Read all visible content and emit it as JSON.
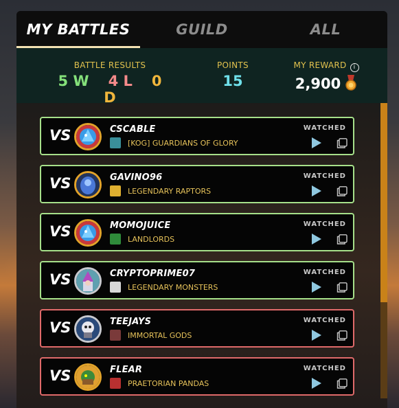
{
  "tabs": [
    {
      "label": "MY BATTLES",
      "active": true
    },
    {
      "label": "GUILD",
      "active": false
    },
    {
      "label": "ALL",
      "active": false
    }
  ],
  "summary": {
    "battle_results_label": "BATTLE RESULTS",
    "wins": "5 W",
    "losses": "4 L",
    "draws": "0 D",
    "points_label": "POINTS",
    "points": "15",
    "reward_label": "MY REWARD",
    "reward": "2,900"
  },
  "battles": [
    {
      "vs": "VS",
      "player": "CSCABLE",
      "guild": "[KOG] GUARDIANS OF GLORY",
      "status": "WATCHED",
      "result": "win",
      "guild_color": "#3a8f9a",
      "avatar_icon": "blue-dragon-avatar-icon"
    },
    {
      "vs": "VS",
      "player": "GAVINO96",
      "guild": "LEGENDARY RAPTORS",
      "status": "WATCHED",
      "result": "win",
      "guild_color": "#e0b030",
      "avatar_icon": "blue-mage-avatar-icon"
    },
    {
      "vs": "VS",
      "player": "MOMOJUICE",
      "guild": "LANDLORDS",
      "status": "WATCHED",
      "result": "win",
      "guild_color": "#2f8c3a",
      "avatar_icon": "blue-dragon-avatar-icon"
    },
    {
      "vs": "VS",
      "player": "CRYPTOPRIME07",
      "guild": "LEGENDARY MONSTERS",
      "status": "WATCHED",
      "result": "win",
      "guild_color": "#d8d8d8",
      "avatar_icon": "wizard-avatar-icon"
    },
    {
      "vs": "VS",
      "player": "TEEJAYS",
      "guild": "IMMORTAL GODS",
      "status": "WATCHED",
      "result": "loss",
      "guild_color": "#7a3a3a",
      "avatar_icon": "skull-knight-avatar-icon"
    },
    {
      "vs": "VS",
      "player": "FLEAR",
      "guild": "PRAETORIAN PANDAS",
      "status": "WATCHED",
      "result": "loss",
      "guild_color": "#b83030",
      "avatar_icon": "green-goblin-avatar-icon"
    }
  ],
  "colors": {
    "win_border": "#a6e08a",
    "loss_border": "#e06a6a",
    "label_gold": "#e2c24e",
    "scroll_thumb": "#c98219"
  }
}
